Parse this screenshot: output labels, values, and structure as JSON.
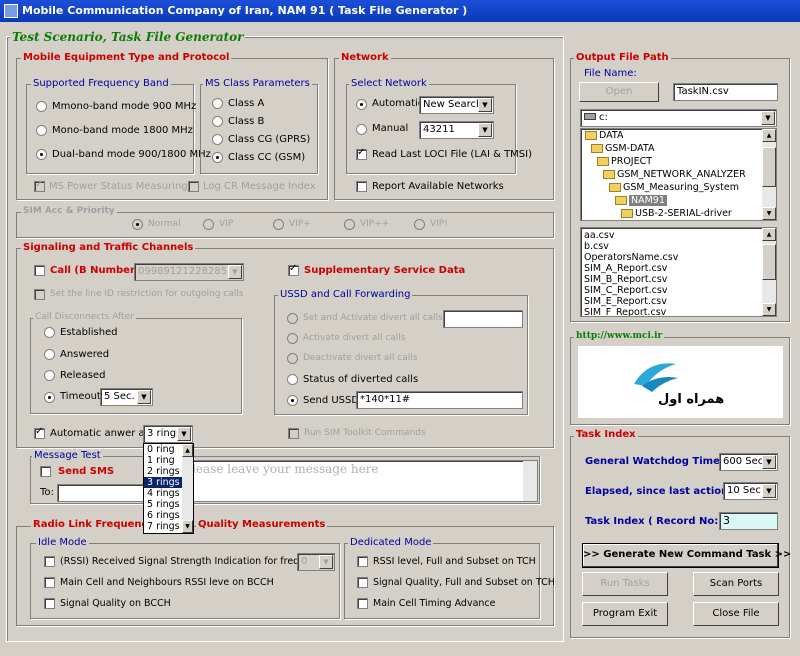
{
  "window": {
    "title": "Mobile Communication Company of Iran, NAM 91 ( Task File Generator )"
  },
  "main_group": "Test Scenario, Task File Generator",
  "mobile_eq": {
    "title": "Mobile Equipment Type and Protocol",
    "freq_band": {
      "title": "Supported Frequency Band",
      "options": [
        "Mmono-band mode 900 MHz",
        "Mono-band mode 1800 MHz",
        "Dual-band mode 900/1800 MHz"
      ]
    },
    "ms_class": {
      "title": "MS Class Parameters",
      "options": [
        "Class A",
        "Class B",
        "Class CG (GPRS)",
        "Class CC (GSM)"
      ]
    },
    "power_status": "MS Power Status Measuring",
    "log_cr": "Log CR Message Index"
  },
  "network": {
    "title": "Network",
    "select_title": "Select Network",
    "automatic": "Automatic",
    "auto_value": "New Search",
    "manual": "Manual",
    "manual_value": "43211",
    "read_loci": "Read Last LOCI File (LAI & TMSI)",
    "report": "Report  Available Networks"
  },
  "sim_acc": {
    "title": "SIM Acc & Priority",
    "options": [
      "Normal",
      "VIP",
      "VIP+",
      "VIP++",
      "VIP!"
    ]
  },
  "signaling": {
    "title": "Signaling and Traffic Channels",
    "call_label": "Call (B Number):",
    "call_value": "09989121228285",
    "line_id": "Set the line ID restriction for outgoing calls",
    "supp": "Supplementary Service Data",
    "disconnect": {
      "title": "Call Disconnects After",
      "options": [
        "Established",
        "Answered",
        "Released",
        "Timeout"
      ],
      "timeout_value": "5  Sec."
    },
    "ussd": {
      "title": "USSD and Call Forwarding",
      "options": [
        "Set and Activate divert all calls to:",
        "Activate divert all calls",
        "Deactivate divert all calls",
        "Status of diverted calls",
        "Send USSD"
      ],
      "ussd_value": "*140*11#"
    },
    "auto_answer": "Automatic anwer after",
    "auto_answer_value": "3 rings",
    "rings_options": [
      "0  ring",
      "1  ring",
      "2  rings",
      "3  rings",
      "4  rings",
      "5  rings",
      "6  rings",
      "7  rings"
    ],
    "sim_toolkit": "Run SIM Toolkit Commands"
  },
  "message": {
    "title": "Message Test",
    "send_sms": "Send SMS",
    "to": "To:",
    "placeholder": "Please leave your message here"
  },
  "radio": {
    "title_a": "Radio Link Frequency",
    "title_b": "Quality Measurements",
    "idle": {
      "title": "Idle Mode",
      "items": [
        "(RSSI) Received Signal Strength Indication for frequency",
        "Main Cell and Neighbours RSSI leve on BCCH",
        "Signal Quality on BCCH"
      ],
      "freq_value": "0"
    },
    "dedicated": {
      "title": "Dedicated Mode",
      "items": [
        "RSSI level, Full and Subset on TCH",
        "Signal Quality, Full and Subset on TCH",
        "Main Cell Timing Advance"
      ]
    }
  },
  "output": {
    "title": "Output File Path",
    "file_name": "File Name:",
    "open": "Open",
    "file_value": "TaskIN.csv",
    "drive": "c:",
    "folders": [
      "DATA",
      "GSM-DATA",
      "PROJECT",
      "GSM_NETWORK_ANALYZER",
      "GSM_Measuring_System",
      "NAM91",
      "USB-2-SERIAL-driver"
    ],
    "files": [
      "aa.csv",
      "b.csv",
      "OperatorsName.csv",
      "SIM_A_Report.csv",
      "SIM_B_Report.csv",
      "SIM_C_Report.csv",
      "SIM_E_Report.csv",
      "SIM_F_Report.csv"
    ]
  },
  "website": {
    "url": "http://www.mci.ir",
    "logo_text": "همراه اول"
  },
  "task": {
    "title": "Task Index",
    "watchdog": "General Watchdog Timer",
    "watchdog_value": "600 Sec.",
    "elapsed": "Elapsed, since last action",
    "elapsed_value": "10 Sec",
    "index_label": "Task Index ( Record No:)",
    "index_value": "3",
    "generate": ">> Generate New Command Task >>",
    "run": "Run Tasks",
    "scan": "Scan Ports",
    "exit": "Program Exit",
    "close": "Close File"
  }
}
